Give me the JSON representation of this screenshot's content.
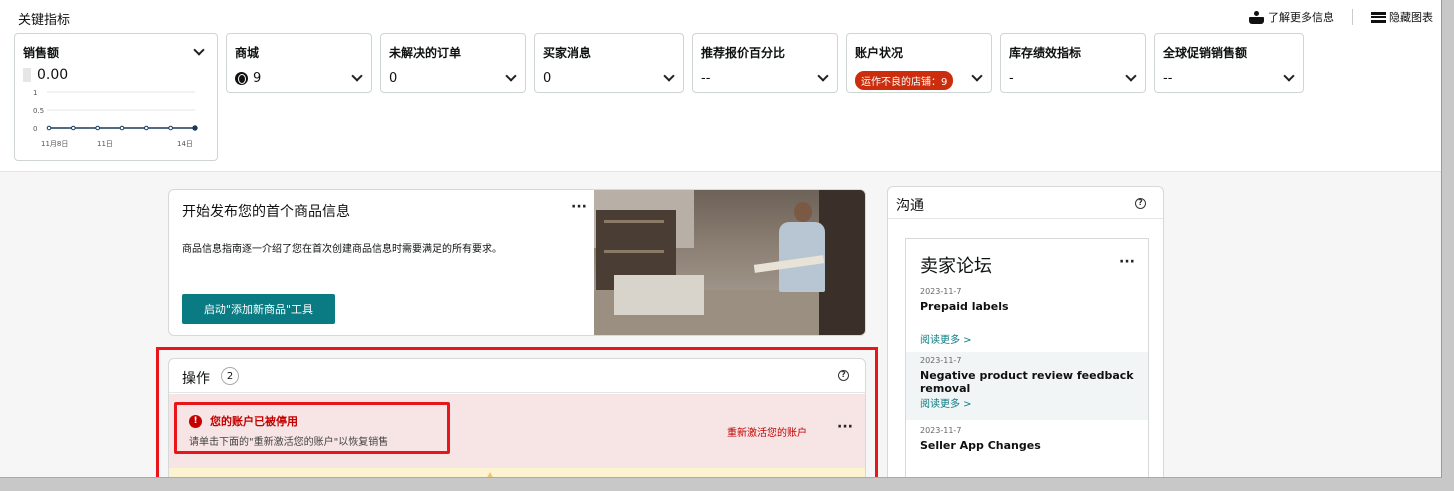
{
  "header": {
    "title": "关键指标",
    "learn_more": "了解更多信息",
    "hide_chart": "隐藏图表"
  },
  "metrics": [
    {
      "label": "销售额",
      "value": "0.00"
    },
    {
      "label": "商城",
      "value": "9"
    },
    {
      "label": "未解决的订单",
      "value": "0"
    },
    {
      "label": "买家消息",
      "value": "0"
    },
    {
      "label": "推荐报价百分比",
      "value": "--"
    },
    {
      "label": "账户状况",
      "value": "运作不良的店铺：9"
    },
    {
      "label": "库存绩效指标",
      "value": "-"
    },
    {
      "label": "全球促销销售额",
      "value": "--"
    }
  ],
  "chart_data": {
    "type": "line",
    "x_ticks": [
      "11月8日",
      "11日",
      "14日"
    ],
    "y_ticks": [
      "1",
      "0.5",
      "0"
    ],
    "ylim": [
      0,
      1
    ],
    "series": [
      {
        "values": [
          0,
          0,
          0,
          0,
          0,
          0,
          0
        ]
      }
    ]
  },
  "start_card": {
    "title": "开始发布您的首个商品信息",
    "desc": "商品信息指南逐一介绍了您在首次创建商品信息时需要满足的所有要求。",
    "button": "启动\"添加新商品\"工具"
  },
  "ops_card": {
    "title": "操作",
    "count": "2",
    "alert_title": "您的账户已被停用",
    "alert_sub": "请单击下面的\"重新激活您的账户\"以恢复销售",
    "action": "重新激活您的账户"
  },
  "comm_card": {
    "title": "沟通",
    "forum_title": "卖家论坛",
    "posts": [
      {
        "date": "2023-11-7",
        "title": "Prepaid labels",
        "more": "阅读更多 >"
      },
      {
        "date": "2023-11-7",
        "title": "Negative product review feedback removal",
        "more": "阅读更多 >"
      },
      {
        "date": "2023-11-7",
        "title": "Seller App Changes"
      }
    ]
  }
}
